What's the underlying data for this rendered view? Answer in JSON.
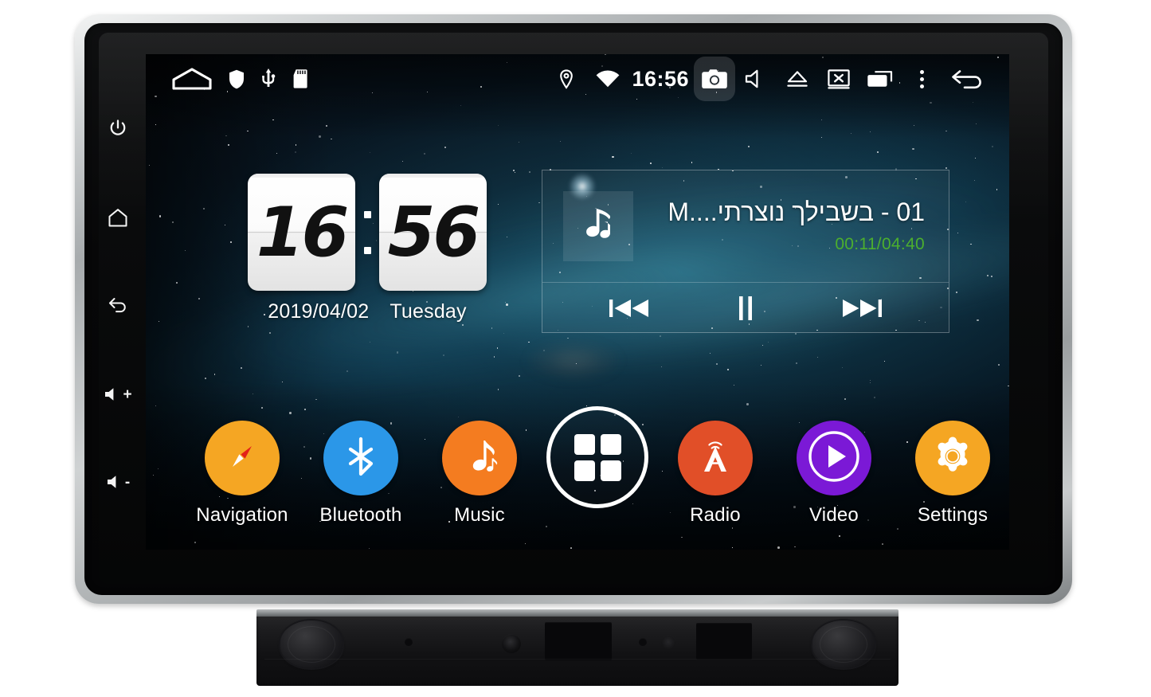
{
  "device": {
    "name": "car-head-unit",
    "hardware_keys": [
      {
        "name": "power",
        "icon": "power-icon",
        "label": ""
      },
      {
        "name": "home",
        "icon": "home-icon",
        "label": ""
      },
      {
        "name": "back",
        "icon": "back-arrow-icon",
        "label": ""
      },
      {
        "name": "volume-up",
        "icon": "volume-icon",
        "label": "+"
      },
      {
        "name": "volume-down",
        "icon": "volume-icon",
        "label": "-"
      }
    ]
  },
  "statusbar": {
    "clock": "16:56",
    "left_icons": [
      {
        "name": "home-indicator-icon",
        "icon": "home"
      },
      {
        "name": "shield-icon",
        "icon": "shield"
      },
      {
        "name": "usb-icon",
        "icon": "usb"
      },
      {
        "name": "sdcard-icon",
        "icon": "sdcard"
      }
    ],
    "right_icons": [
      {
        "name": "location-icon",
        "icon": "pin"
      },
      {
        "name": "wifi-icon",
        "icon": "wifi"
      },
      {
        "name": "camera-icon",
        "icon": "camera",
        "pressed": true
      },
      {
        "name": "mute-icon",
        "icon": "speaker-mute"
      },
      {
        "name": "eject-icon",
        "icon": "eject"
      },
      {
        "name": "screen-off-icon",
        "icon": "screen-x"
      },
      {
        "name": "recents-icon",
        "icon": "recents"
      },
      {
        "name": "overflow-menu-icon",
        "icon": "three-dots"
      },
      {
        "name": "back-icon",
        "icon": "back-arrow"
      }
    ]
  },
  "clock_widget": {
    "hours": "16",
    "minutes": "56",
    "date": "2019/04/02",
    "weekday": "Tuesday"
  },
  "music_widget": {
    "track_title": "01 - בשבילך נוצרתי....M",
    "elapsed": "00:11",
    "duration": "04:40",
    "time_display": "00:11/04:40",
    "time_color": "#4caf2e",
    "album_art_icon": "music-note-icon",
    "controls": [
      {
        "name": "previous-track-button",
        "icon": "skip-previous"
      },
      {
        "name": "pause-button",
        "icon": "pause"
      },
      {
        "name": "next-track-button",
        "icon": "skip-next"
      }
    ]
  },
  "dock": {
    "apps": [
      {
        "name": "navigation",
        "label": "Navigation",
        "icon": "compass-icon",
        "color": "#f5a623"
      },
      {
        "name": "bluetooth",
        "label": "Bluetooth",
        "icon": "bluetooth-icon",
        "color": "#2b97e8"
      },
      {
        "name": "music",
        "label": "Music",
        "icon": "music-note-icon",
        "color": "#f47c20"
      },
      {
        "name": "apps",
        "label": "",
        "icon": "apps-grid-icon",
        "color": "transparent"
      },
      {
        "name": "radio",
        "label": "Radio",
        "icon": "radio-tower-icon",
        "color": "#e14f28"
      },
      {
        "name": "video",
        "label": "Video",
        "icon": "play-icon",
        "color": "#7b19d6"
      },
      {
        "name": "settings",
        "label": "Settings",
        "icon": "gear-icon",
        "color": "#f5a623"
      }
    ]
  }
}
